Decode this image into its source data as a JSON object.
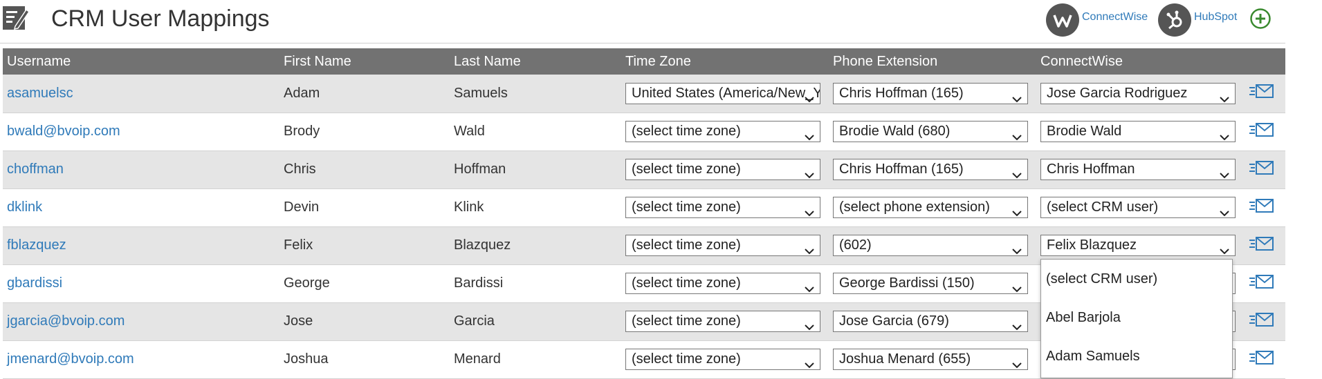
{
  "header": {
    "title": "CRM User Mappings",
    "crms": [
      {
        "name": "ConnectWise",
        "icon": "connectwise-logo-icon"
      },
      {
        "name": "HubSpot",
        "icon": "hubspot-logo-icon"
      }
    ],
    "add_icon": "plus-circle-icon"
  },
  "table": {
    "columns": [
      "Username",
      "First Name",
      "Last Name",
      "Time Zone",
      "Phone Extension",
      "ConnectWise"
    ],
    "rows": [
      {
        "username": "asamuelsc",
        "first": "Adam",
        "last": "Samuels",
        "tz": "United States (America/New_York)",
        "phone": "Chris Hoffman (165)",
        "crm": "Jose Garcia Rodriguez"
      },
      {
        "username": "bwald@bvoip.com",
        "first": "Brody",
        "last": "Wald",
        "tz": "(select time zone)",
        "phone": "Brodie Wald (680)",
        "crm": "Brodie Wald"
      },
      {
        "username": "choffman",
        "first": "Chris",
        "last": "Hoffman",
        "tz": "(select time zone)",
        "phone": "Chris Hoffman (165)",
        "crm": "Chris Hoffman"
      },
      {
        "username": "dklink",
        "first": "Devin",
        "last": "Klink",
        "tz": "(select time zone)",
        "phone": "(select phone extension)",
        "crm": "(select CRM user)"
      },
      {
        "username": "fblazquez",
        "first": "Felix",
        "last": "Blazquez",
        "tz": "(select time zone)",
        "phone": "(602)",
        "crm": "Felix Blazquez"
      },
      {
        "username": "gbardissi",
        "first": "George",
        "last": "Bardissi",
        "tz": "(select time zone)",
        "phone": "George Bardissi (150)",
        "crm": ""
      },
      {
        "username": "jgarcia@bvoip.com",
        "first": "Jose",
        "last": "Garcia",
        "tz": "(select time zone)",
        "phone": "Jose Garcia (679)",
        "crm": ""
      },
      {
        "username": "jmenard@bvoip.com",
        "first": "Joshua",
        "last": "Menard",
        "tz": "(select time zone)",
        "phone": "Joshua Menard (655)",
        "crm": ""
      }
    ],
    "row_action_icon": "send-email-icon"
  },
  "crm_dropdown": {
    "open_for_row": "fblazquez",
    "options": [
      "(select CRM user)",
      "Abel Barjola",
      "Adam Samuels"
    ]
  },
  "colors": {
    "header_bg": "#727272",
    "link": "#2f7ab9",
    "alt_row": "#e5e5e5",
    "add_green": "#3a8a2f"
  }
}
